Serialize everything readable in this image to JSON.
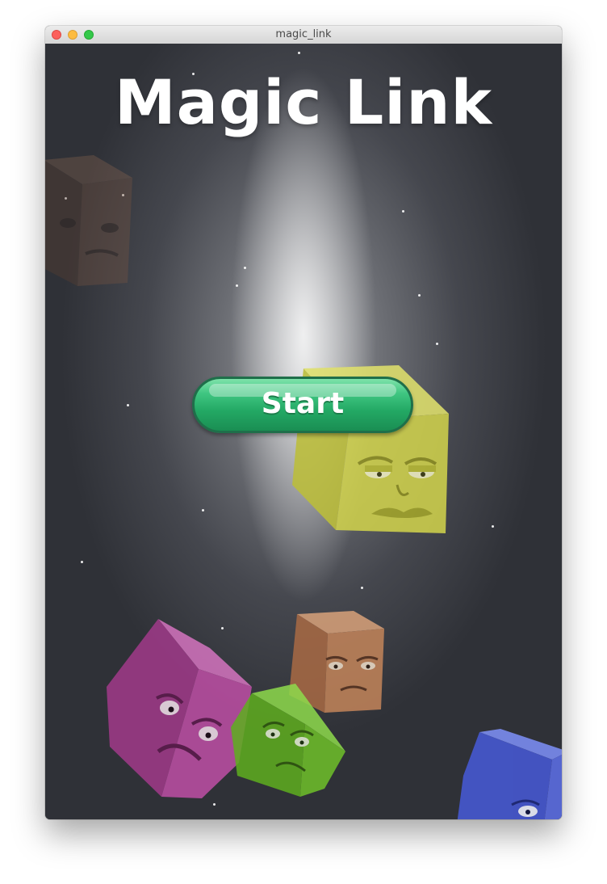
{
  "window": {
    "title": "magic_link"
  },
  "game": {
    "title": "Magic Link",
    "start_label": "Start"
  },
  "blocks": [
    {
      "name": "brown-block-faded",
      "color": "#6b4a3a"
    },
    {
      "name": "yellow-block",
      "color": "#d3d34a"
    },
    {
      "name": "orange-block",
      "color": "#c98a5e"
    },
    {
      "name": "magenta-block",
      "color": "#b8439a"
    },
    {
      "name": "green-block",
      "color": "#73c22f"
    },
    {
      "name": "blue-block",
      "color": "#4a62d8"
    }
  ]
}
